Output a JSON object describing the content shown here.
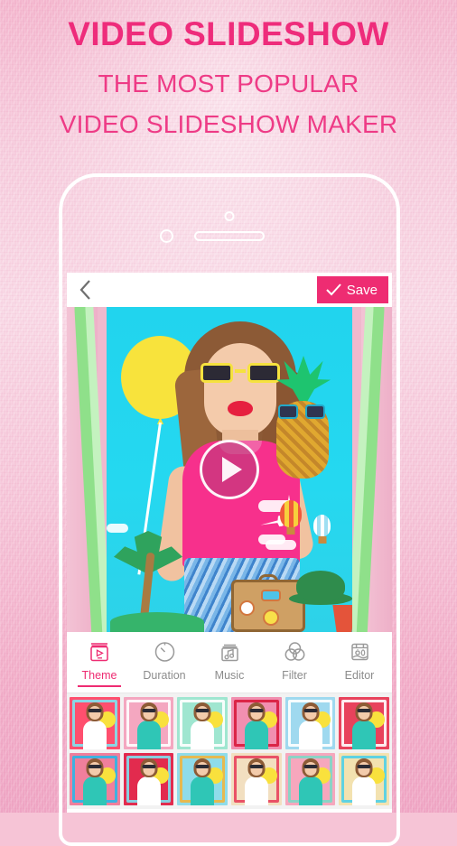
{
  "headline": {
    "title": "VIDEO SLIDESHOW",
    "subtitle_line1": "THE MOST POPULAR",
    "subtitle_line2": "VIDEO SLIDESHOW MAKER"
  },
  "colors": {
    "brand_pink": "#ee2c72",
    "headline_pink": "#ee2c7b",
    "subtitle_pink": "#ee3b86",
    "tab_inactive": "#8c8c8c",
    "screen_bg": "#ffffff",
    "thumb_strip_bg": "#f2f2f2",
    "background_pink": "#f4b8cf"
  },
  "app": {
    "topbar": {
      "back_icon": "chevron-left-icon",
      "save_label": "Save",
      "save_icon": "check-icon"
    },
    "preview": {
      "play_icon": "play-icon",
      "description": "Woman with yellow sunglasses holding pineapple and yellow balloon on cyan background with travel stickers"
    },
    "tabs": [
      {
        "label": "Theme",
        "icon": "theme-book-play-icon",
        "active": true
      },
      {
        "label": "Duration",
        "icon": "clock-icon",
        "active": false
      },
      {
        "label": "Music",
        "icon": "music-note-box-icon",
        "active": false
      },
      {
        "label": "Filter",
        "icon": "three-circles-icon",
        "active": false
      },
      {
        "label": "Editor",
        "icon": "photo-edit-icon",
        "active": false
      }
    ],
    "themes": {
      "rows": [
        [
          {
            "name": "heart-frame",
            "bg": "#ff4f6e",
            "accent": "#7fe3ef",
            "shirt": "#ffffff"
          },
          {
            "name": "pink-window",
            "bg": "#f4a7c0",
            "accent": "#ffffff",
            "shirt": "#2fc6b6"
          },
          {
            "name": "mint-border",
            "bg": "#9fe6d0",
            "accent": "#ffffff",
            "shirt": "#ffffff"
          },
          {
            "name": "valentine-card",
            "bg": "#f18fb0",
            "accent": "#d81a3c",
            "shirt": "#2fc6b6"
          },
          {
            "name": "sky-clouds",
            "bg": "#9fd9ef",
            "accent": "#ffffff",
            "shirt": "#ffffff"
          },
          {
            "name": "red-stripe",
            "bg": "#e8425c",
            "accent": "#ffffff",
            "shirt": "#2fc6b6"
          }
        ],
        [
          {
            "name": "beach-umbrella",
            "bg": "#f07f9c",
            "accent": "#29b7e8",
            "shirt": "#2fc6b6"
          },
          {
            "name": "hearts-circle",
            "bg": "#e22b4e",
            "accent": "#7fe0ef",
            "shirt": "#ffffff"
          },
          {
            "name": "sand-wave",
            "bg": "#8fdcea",
            "accent": "#f0b53f",
            "shirt": "#2fc6b6"
          },
          {
            "name": "picnic-party",
            "bg": "#f2dfc0",
            "accent": "#e8425c",
            "shirt": "#ffffff"
          },
          {
            "name": "coconut-tropic",
            "bg": "#f6a7bd",
            "accent": "#7fd7c5",
            "shirt": "#2fc6b6"
          },
          {
            "name": "gold-frame",
            "bg": "#f3e2b0",
            "accent": "#4fd0e8",
            "shirt": "#ffffff"
          }
        ]
      ]
    }
  }
}
